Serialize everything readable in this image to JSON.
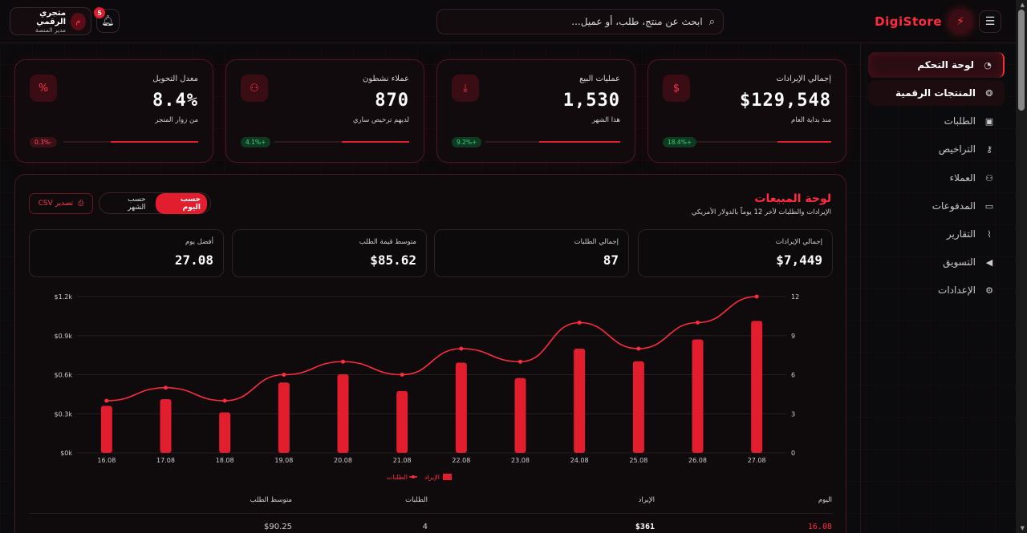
{
  "header": {
    "brand": "DigiStore",
    "menu_icon": "☰",
    "bolt_icon": "⚡",
    "search_placeholder": "ابحث عن منتج، طلب، أو عميل...",
    "notifications_count": "5",
    "user": {
      "name": "متجري الرقمي",
      "role": "مدير المنصة",
      "avatar_letter": "م"
    }
  },
  "sidebar": {
    "items": [
      {
        "label": "لوحة التحكم",
        "icon": "◔"
      },
      {
        "label": "المنتجات الرقمية",
        "icon": "❂"
      },
      {
        "label": "الطلبات",
        "icon": "▣"
      },
      {
        "label": "التراخيص",
        "icon": "⚷"
      },
      {
        "label": "العملاء",
        "icon": "⚇"
      },
      {
        "label": "المدفوعات",
        "icon": "▭"
      },
      {
        "label": "التقارير",
        "icon": "⌇"
      },
      {
        "label": "التسويق",
        "icon": "◀"
      },
      {
        "label": "الإعدادات",
        "icon": "⚙"
      }
    ]
  },
  "cards": [
    {
      "title": "إجمالي الإيرادات",
      "value": "$129,548",
      "sub": "منذ بداية العام",
      "delta": "18.4%+",
      "trend": "up",
      "icon": "$",
      "progress": 0.4
    },
    {
      "title": "عمليات البيع",
      "value": "1,530",
      "sub": "هذا الشهر",
      "delta": "9.2%+",
      "trend": "up",
      "icon": "⤓",
      "progress": 0.6
    },
    {
      "title": "عملاء نشطون",
      "value": "870",
      "sub": "لديهم ترخيص ساري",
      "delta": "4.1%+",
      "trend": "up",
      "icon": "⚇",
      "progress": 0.5
    },
    {
      "title": "معدل التحويل",
      "value": "8.4%",
      "sub": "من زوار المتجر",
      "delta": "0.3%-",
      "trend": "down",
      "icon": "%",
      "progress": 0.65
    }
  ],
  "panel": {
    "title": "لوحة المبيعات",
    "subtitle": "الإيرادات والطلبات لآخر 12 يوماً بالدولار الأمريكي",
    "toggle_day": "حسب اليوم",
    "toggle_month": "حسب الشهر",
    "export": "تصدير CSV",
    "stats": [
      {
        "label": "إجمالي الإيرادات",
        "value": "$7,449"
      },
      {
        "label": "إجمالي الطلبات",
        "value": "87"
      },
      {
        "label": "متوسط قيمة الطلب",
        "value": "$85.62"
      },
      {
        "label": "أفضل يوم",
        "value": "27.08"
      }
    ]
  },
  "chart_data": {
    "type": "bar",
    "categories": [
      "16.08",
      "17.08",
      "18.08",
      "19.08",
      "20.08",
      "21.08",
      "22.08",
      "23.08",
      "24.08",
      "25.08",
      "26.08",
      "27.08"
    ],
    "series": [
      {
        "name": "الإيراد",
        "type": "bar",
        "axis": "left",
        "color": "#e11d2e",
        "values": [
          361,
          412,
          311,
          540,
          603,
          475,
          692,
          575,
          800,
          703,
          871,
          1013
        ]
      },
      {
        "name": "الطلبات",
        "type": "line",
        "axis": "right",
        "color": "#ff2b3f",
        "values": [
          4,
          5,
          4,
          6,
          7,
          6,
          8,
          7,
          10,
          8,
          10,
          12
        ]
      }
    ],
    "y_left_ticks": [
      "$0k",
      "$0.3k",
      "$0.6k",
      "$0.9k",
      "$1.2k"
    ],
    "y_left_lim": [
      0,
      1200
    ],
    "y_right_ticks": [
      "0",
      "3",
      "6",
      "9",
      "12"
    ],
    "y_right_lim": [
      0,
      12
    ],
    "legend_position": "bottom"
  },
  "table": {
    "headers": {
      "day": "اليوم",
      "revenue": "الإيراد",
      "orders": "الطلبات",
      "avg": "متوسط الطلب"
    },
    "first_row": {
      "day": "16.08",
      "revenue": "$361",
      "orders": "4",
      "avg": "$90.25"
    }
  }
}
